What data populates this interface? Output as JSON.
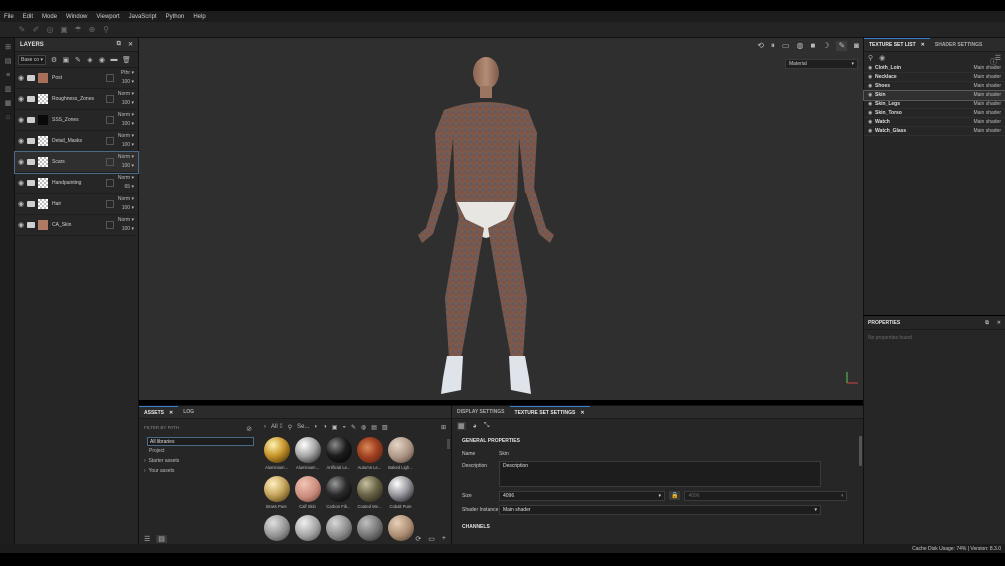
{
  "menu": [
    "File",
    "Edit",
    "Mode",
    "Window",
    "Viewport",
    "JavaScript",
    "Python",
    "Help"
  ],
  "layers": {
    "title": "LAYERS",
    "channel": "Base co",
    "items": [
      {
        "name": "Post",
        "blend": "Pthr",
        "opacity": "100",
        "thumb": "#a8705a"
      },
      {
        "name": "Roughness_Zones",
        "blend": "Norm",
        "opacity": "100",
        "thumb": "checker"
      },
      {
        "name": "SSS_Zones",
        "blend": "Norm",
        "opacity": "100",
        "thumb": "#0a0a0a"
      },
      {
        "name": "Detail_Masks",
        "blend": "Norm",
        "opacity": "100",
        "thumb": "checker"
      },
      {
        "name": "Scars",
        "blend": "Norm",
        "opacity": "100",
        "thumb": "checker"
      },
      {
        "name": "Handpainting",
        "blend": "Norm",
        "opacity": "65",
        "thumb": "checker"
      },
      {
        "name": "Hair",
        "blend": "Norm",
        "opacity": "100",
        "thumb": "checker"
      },
      {
        "name": "CA_Skin",
        "blend": "Norm",
        "opacity": "100",
        "thumb": "#b07a64"
      }
    ]
  },
  "viewport": {
    "material_select": "Material"
  },
  "texture_set_list": {
    "tab_active": "TEXTURE SET LIST",
    "tab_other": "SHADER SETTINGS",
    "items": [
      {
        "name": "Cloth_Loin",
        "shader": "Main shader"
      },
      {
        "name": "Necklace",
        "shader": "Main shader"
      },
      {
        "name": "Shoes",
        "shader": "Main shader"
      },
      {
        "name": "Skin",
        "shader": "Main shader"
      },
      {
        "name": "Skin_Legs",
        "shader": "Main shader"
      },
      {
        "name": "Skin_Torso",
        "shader": "Main shader"
      },
      {
        "name": "Watch",
        "shader": "Main shader"
      },
      {
        "name": "Watch_Glass",
        "shader": "Main shader"
      }
    ]
  },
  "properties": {
    "title": "PROPERTIES",
    "empty": "No properties found"
  },
  "assets": {
    "tab_assets": "ASSETS",
    "tab_log": "LOG",
    "filter_label": "FILTER BY PATH",
    "libraries": [
      "All libraries",
      "Project"
    ],
    "tree": [
      "Starter assets",
      "Your assets"
    ],
    "all_label": "All",
    "search_label": "Se...",
    "materials": [
      {
        "label": "Aluminium...",
        "color": "gold"
      },
      {
        "label": "Aluminium...",
        "color": "silver"
      },
      {
        "label": "Artificial Le...",
        "color": "black"
      },
      {
        "label": "Autumn Le...",
        "color": "leaf"
      },
      {
        "label": "Baked Ligh...",
        "color": "beige"
      },
      {
        "label": "Brass Pure",
        "color": "brass"
      },
      {
        "label": "Calf Skin",
        "color": "pink"
      },
      {
        "label": "Carbon Fib...",
        "color": "carbon"
      },
      {
        "label": "Coated Me...",
        "color": "olive"
      },
      {
        "label": "Cobalt Pure",
        "color": "chrome"
      },
      {
        "label": "",
        "color": "grey1"
      },
      {
        "label": "",
        "color": "grey2"
      },
      {
        "label": "",
        "color": "grey3"
      },
      {
        "label": "",
        "color": "grey4"
      },
      {
        "label": "",
        "color": "tan"
      }
    ]
  },
  "texture_set_settings": {
    "tab_display": "DISPLAY SETTINGS",
    "tab_active": "TEXTURE SET SETTINGS",
    "section_general": "GENERAL PROPERTIES",
    "name_label": "Name",
    "name_value": "Skin",
    "desc_label": "Description",
    "desc_value": "Description",
    "size_label": "Size",
    "size_value": "4096",
    "size_linked": "4096",
    "shader_label": "Shader Instance",
    "shader_value": "Main shader",
    "section_channels": "CHANNELS"
  },
  "status": {
    "text": "Cache Disk Usage:  74% | Version: 8.3.0"
  }
}
